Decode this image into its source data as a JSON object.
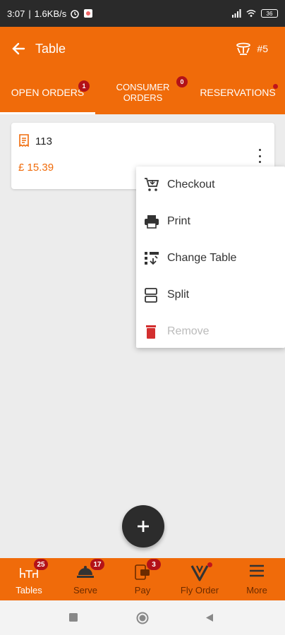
{
  "status_bar": {
    "time": "3:07",
    "speed": "1.6KB/s",
    "battery": "36"
  },
  "app_bar": {
    "title": "Table",
    "table_number": "#5"
  },
  "tabs": [
    {
      "label": "OPEN ORDERS",
      "badge": "1"
    },
    {
      "label": "CONSUMER\nORDERS",
      "badge": "0"
    },
    {
      "label": "RESERVATIONS"
    }
  ],
  "order": {
    "number": "113",
    "price": "£ 15.39"
  },
  "menu": [
    {
      "label": "Checkout"
    },
    {
      "label": "Print"
    },
    {
      "label": "Change Table"
    },
    {
      "label": "Split"
    },
    {
      "label": "Remove"
    }
  ],
  "bottom_nav": [
    {
      "label": "Tables",
      "badge": "25"
    },
    {
      "label": "Serve",
      "badge": "17"
    },
    {
      "label": "Pay",
      "badge": "3"
    },
    {
      "label": "Fly Order"
    },
    {
      "label": "More"
    }
  ],
  "colors": {
    "primary": "#f06b0a",
    "badge": "#b31218",
    "remove": "#d32f2f"
  }
}
